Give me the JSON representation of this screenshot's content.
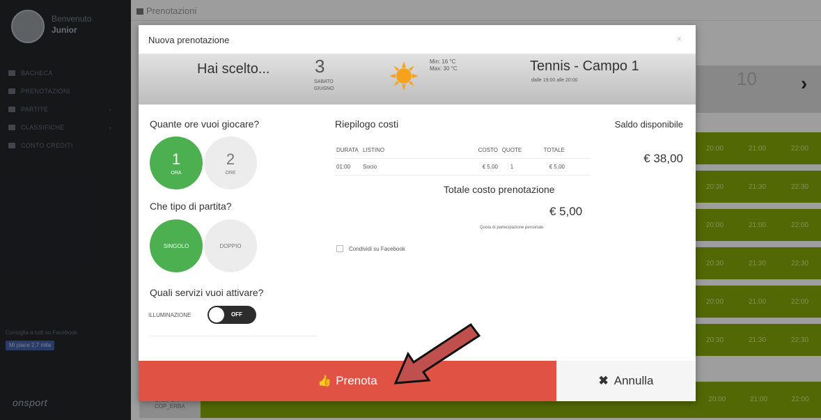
{
  "sidebar": {
    "welcome": "Benvenuto",
    "username": "Junior",
    "menu": [
      {
        "label": "BACHECA",
        "icon": "dashboard-icon",
        "has_arrow": false
      },
      {
        "label": "PRENOTAZIONI",
        "icon": "calendar-icon",
        "has_arrow": false
      },
      {
        "label": "PARTITE",
        "icon": "list-icon",
        "has_arrow": true
      },
      {
        "label": "CLASSIFICHE",
        "icon": "trophy-icon",
        "has_arrow": true
      },
      {
        "label": "CONTO CREDITI",
        "icon": "wallet-icon",
        "has_arrow": false
      }
    ],
    "fb_promo": "Consiglia a tutti su Facebook",
    "fb_like": "Mi piace 2,7 mila",
    "logo": "onsport"
  },
  "page": {
    "title": "Prenotazioni",
    "bg_date_num": "10",
    "grid_times": [
      [
        "20:00",
        "21:00",
        "22:00"
      ],
      [
        "20:30",
        "21:30",
        "22:30"
      ],
      [
        "20:00",
        "21:00",
        "22:00"
      ],
      [
        "20:30",
        "21:30",
        "22:30"
      ],
      [
        "20:00",
        "21:00",
        "22:00"
      ],
      [
        "20:30",
        "21:30",
        "22:30"
      ]
    ],
    "bottom_court": "CAMPO 7 COP_ERBA",
    "bottom_times": [
      "20:00",
      "21:00",
      "22:00"
    ]
  },
  "modal": {
    "title": "Nuova prenotazione",
    "close": "×",
    "chosen_label": "Hai scelto...",
    "date": {
      "day": "3",
      "weekday": "SABATO",
      "month": "GIUGNO"
    },
    "weather": {
      "icon": "sun-icon",
      "min": "Min: 16 °C",
      "max": "Max: 30 °C"
    },
    "court": {
      "name": "Tennis - Campo 1",
      "time": "dalle 19:00 alle 20:00"
    },
    "hours_question": "Quante ore vuoi giocare?",
    "hours_options": [
      {
        "value": "1",
        "unit": "ORA",
        "selected": true
      },
      {
        "value": "2",
        "unit": "ORE",
        "selected": false
      }
    ],
    "match_question": "Che tipo di partita?",
    "match_options": [
      {
        "label": "SINGOLO",
        "selected": true
      },
      {
        "label": "DOPPIO",
        "selected": false
      }
    ],
    "services_question": "Quali servizi vuoi attivare?",
    "service_lighting": {
      "label": "ILLUMINAZIONE",
      "state": "OFF"
    },
    "costs": {
      "title": "Riepilogo costi",
      "headers": [
        "DURATA",
        "LISTINO",
        "COSTO",
        "QUOTE",
        "TOTALE"
      ],
      "rows": [
        [
          "01:00",
          "Socio",
          "€ 5,00",
          "1",
          "€ 5,00"
        ]
      ],
      "total_label": "Totale costo prenotazione",
      "total_value": "€ 5,00",
      "total_note": "Quota di partecipazione personale"
    },
    "share_facebook": "Condividi su Facebook",
    "balance": {
      "label": "Saldo disponibile",
      "value": "€ 38,00"
    },
    "book_button": "Prenota",
    "cancel_button": "Annulla"
  },
  "colors": {
    "accent_green": "#4caf50",
    "book_red": "#e05344",
    "grid_green": "#7a9a08",
    "arrow_red": "#c0504d"
  }
}
